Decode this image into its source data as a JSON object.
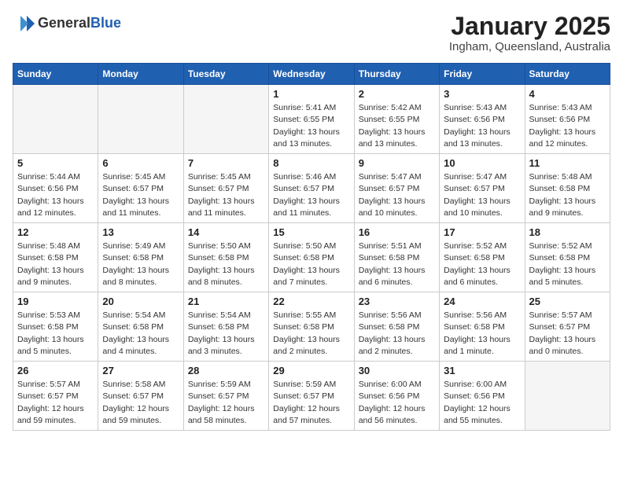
{
  "header": {
    "logo_general": "General",
    "logo_blue": "Blue",
    "main_title": "January 2025",
    "sub_title": "Ingham, Queensland, Australia"
  },
  "days_of_week": [
    "Sunday",
    "Monday",
    "Tuesday",
    "Wednesday",
    "Thursday",
    "Friday",
    "Saturday"
  ],
  "weeks": [
    [
      {
        "date": "",
        "info": ""
      },
      {
        "date": "",
        "info": ""
      },
      {
        "date": "",
        "info": ""
      },
      {
        "date": "1",
        "info": "Sunrise: 5:41 AM\nSunset: 6:55 PM\nDaylight: 13 hours\nand 13 minutes."
      },
      {
        "date": "2",
        "info": "Sunrise: 5:42 AM\nSunset: 6:55 PM\nDaylight: 13 hours\nand 13 minutes."
      },
      {
        "date": "3",
        "info": "Sunrise: 5:43 AM\nSunset: 6:56 PM\nDaylight: 13 hours\nand 13 minutes."
      },
      {
        "date": "4",
        "info": "Sunrise: 5:43 AM\nSunset: 6:56 PM\nDaylight: 13 hours\nand 12 minutes."
      }
    ],
    [
      {
        "date": "5",
        "info": "Sunrise: 5:44 AM\nSunset: 6:56 PM\nDaylight: 13 hours\nand 12 minutes."
      },
      {
        "date": "6",
        "info": "Sunrise: 5:45 AM\nSunset: 6:57 PM\nDaylight: 13 hours\nand 11 minutes."
      },
      {
        "date": "7",
        "info": "Sunrise: 5:45 AM\nSunset: 6:57 PM\nDaylight: 13 hours\nand 11 minutes."
      },
      {
        "date": "8",
        "info": "Sunrise: 5:46 AM\nSunset: 6:57 PM\nDaylight: 13 hours\nand 11 minutes."
      },
      {
        "date": "9",
        "info": "Sunrise: 5:47 AM\nSunset: 6:57 PM\nDaylight: 13 hours\nand 10 minutes."
      },
      {
        "date": "10",
        "info": "Sunrise: 5:47 AM\nSunset: 6:57 PM\nDaylight: 13 hours\nand 10 minutes."
      },
      {
        "date": "11",
        "info": "Sunrise: 5:48 AM\nSunset: 6:58 PM\nDaylight: 13 hours\nand 9 minutes."
      }
    ],
    [
      {
        "date": "12",
        "info": "Sunrise: 5:48 AM\nSunset: 6:58 PM\nDaylight: 13 hours\nand 9 minutes."
      },
      {
        "date": "13",
        "info": "Sunrise: 5:49 AM\nSunset: 6:58 PM\nDaylight: 13 hours\nand 8 minutes."
      },
      {
        "date": "14",
        "info": "Sunrise: 5:50 AM\nSunset: 6:58 PM\nDaylight: 13 hours\nand 8 minutes."
      },
      {
        "date": "15",
        "info": "Sunrise: 5:50 AM\nSunset: 6:58 PM\nDaylight: 13 hours\nand 7 minutes."
      },
      {
        "date": "16",
        "info": "Sunrise: 5:51 AM\nSunset: 6:58 PM\nDaylight: 13 hours\nand 6 minutes."
      },
      {
        "date": "17",
        "info": "Sunrise: 5:52 AM\nSunset: 6:58 PM\nDaylight: 13 hours\nand 6 minutes."
      },
      {
        "date": "18",
        "info": "Sunrise: 5:52 AM\nSunset: 6:58 PM\nDaylight: 13 hours\nand 5 minutes."
      }
    ],
    [
      {
        "date": "19",
        "info": "Sunrise: 5:53 AM\nSunset: 6:58 PM\nDaylight: 13 hours\nand 5 minutes."
      },
      {
        "date": "20",
        "info": "Sunrise: 5:54 AM\nSunset: 6:58 PM\nDaylight: 13 hours\nand 4 minutes."
      },
      {
        "date": "21",
        "info": "Sunrise: 5:54 AM\nSunset: 6:58 PM\nDaylight: 13 hours\nand 3 minutes."
      },
      {
        "date": "22",
        "info": "Sunrise: 5:55 AM\nSunset: 6:58 PM\nDaylight: 13 hours\nand 2 minutes."
      },
      {
        "date": "23",
        "info": "Sunrise: 5:56 AM\nSunset: 6:58 PM\nDaylight: 13 hours\nand 2 minutes."
      },
      {
        "date": "24",
        "info": "Sunrise: 5:56 AM\nSunset: 6:58 PM\nDaylight: 13 hours\nand 1 minute."
      },
      {
        "date": "25",
        "info": "Sunrise: 5:57 AM\nSunset: 6:57 PM\nDaylight: 13 hours\nand 0 minutes."
      }
    ],
    [
      {
        "date": "26",
        "info": "Sunrise: 5:57 AM\nSunset: 6:57 PM\nDaylight: 12 hours\nand 59 minutes."
      },
      {
        "date": "27",
        "info": "Sunrise: 5:58 AM\nSunset: 6:57 PM\nDaylight: 12 hours\nand 59 minutes."
      },
      {
        "date": "28",
        "info": "Sunrise: 5:59 AM\nSunset: 6:57 PM\nDaylight: 12 hours\nand 58 minutes."
      },
      {
        "date": "29",
        "info": "Sunrise: 5:59 AM\nSunset: 6:57 PM\nDaylight: 12 hours\nand 57 minutes."
      },
      {
        "date": "30",
        "info": "Sunrise: 6:00 AM\nSunset: 6:56 PM\nDaylight: 12 hours\nand 56 minutes."
      },
      {
        "date": "31",
        "info": "Sunrise: 6:00 AM\nSunset: 6:56 PM\nDaylight: 12 hours\nand 55 minutes."
      },
      {
        "date": "",
        "info": ""
      }
    ]
  ]
}
